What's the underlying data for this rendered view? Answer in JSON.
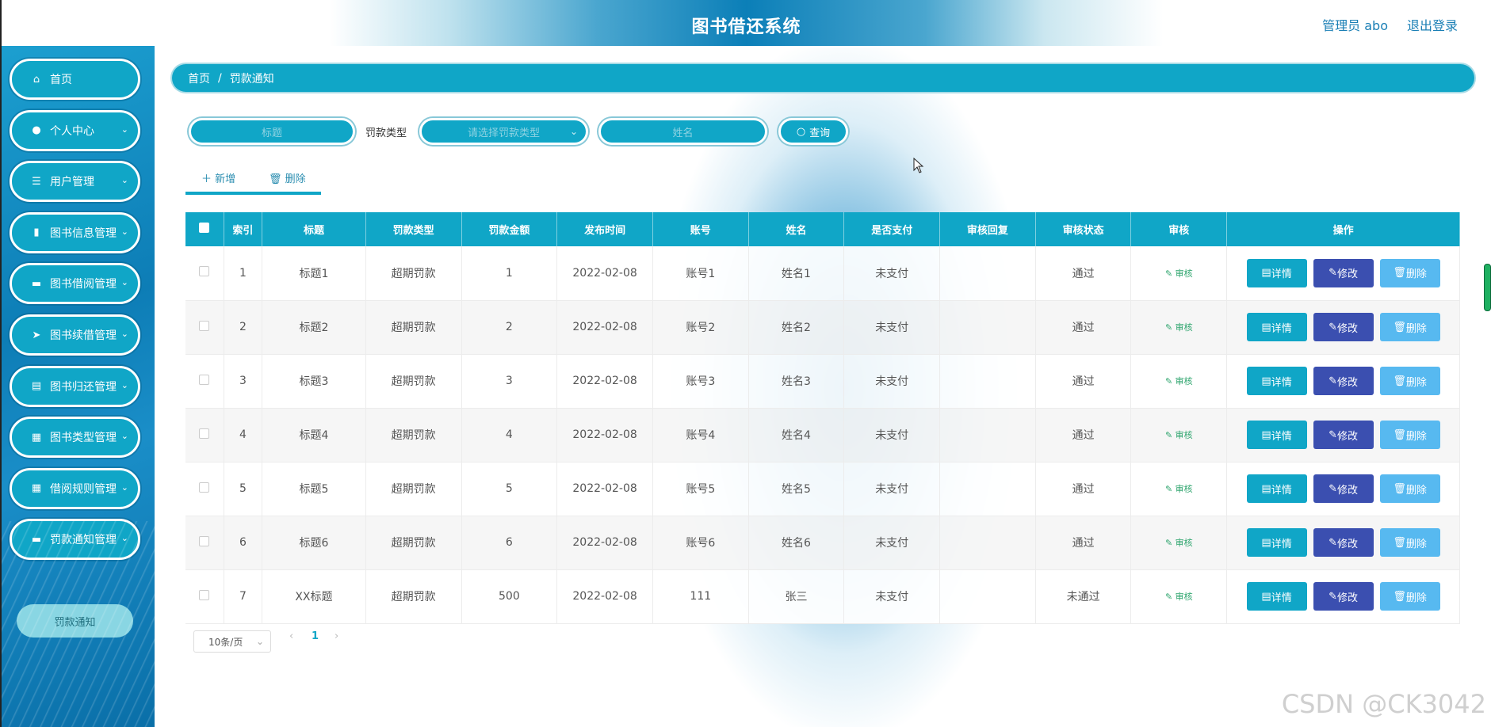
{
  "header": {
    "title": "图书借还系统",
    "user": "管理员 abo",
    "logout": "退出登录"
  },
  "sidebar": {
    "items": [
      {
        "label": "首页",
        "icon": "home-icon",
        "glyph": "⌂",
        "chevron": ""
      },
      {
        "label": "个人中心",
        "icon": "user-icon",
        "glyph": "●",
        "chevron": "⌄"
      },
      {
        "label": "用户管理",
        "icon": "list-icon",
        "glyph": "☰",
        "chevron": "⌄"
      },
      {
        "label": "图书信息管理",
        "icon": "chart-icon",
        "glyph": "▮",
        "chevron": "⌄"
      },
      {
        "label": "图书借阅管理",
        "icon": "briefcase-icon",
        "glyph": "▬",
        "chevron": "⌄"
      },
      {
        "label": "图书续借管理",
        "icon": "send-icon",
        "glyph": "➤",
        "chevron": "⌄"
      },
      {
        "label": "图书归还管理",
        "icon": "clipboard-icon",
        "glyph": "▤",
        "chevron": "⌄"
      },
      {
        "label": "图书类型管理",
        "icon": "grid-icon",
        "glyph": "▦",
        "chevron": "⌄"
      },
      {
        "label": "借阅规则管理",
        "icon": "grid-icon",
        "glyph": "▦",
        "chevron": "⌄"
      },
      {
        "label": "罚款通知管理",
        "icon": "monitor-icon",
        "glyph": "▬",
        "chevron": "⌄"
      }
    ],
    "submenu": "罚款通知"
  },
  "breadcrumb": {
    "home": "首页",
    "sep": "/",
    "current": "罚款通知"
  },
  "search": {
    "title_placeholder": "标题",
    "type_label": "罚款类型",
    "type_placeholder": "请选择罚款类型",
    "name_placeholder": "姓名",
    "button": "查询"
  },
  "actions": {
    "add": "新增",
    "delete": "删除"
  },
  "table": {
    "headers": [
      "索引",
      "标题",
      "罚款类型",
      "罚款金额",
      "发布时间",
      "账号",
      "姓名",
      "是否支付",
      "审核回复",
      "审核状态",
      "审核",
      "操作"
    ],
    "rows": [
      {
        "idx": "1",
        "title": "标题1",
        "type": "超期罚款",
        "amount": "1",
        "date": "2022-02-08",
        "account": "账号1",
        "name": "姓名1",
        "paid": "未支付",
        "reply": "",
        "status": "通过"
      },
      {
        "idx": "2",
        "title": "标题2",
        "type": "超期罚款",
        "amount": "2",
        "date": "2022-02-08",
        "account": "账号2",
        "name": "姓名2",
        "paid": "未支付",
        "reply": "",
        "status": "通过"
      },
      {
        "idx": "3",
        "title": "标题3",
        "type": "超期罚款",
        "amount": "3",
        "date": "2022-02-08",
        "account": "账号3",
        "name": "姓名3",
        "paid": "未支付",
        "reply": "",
        "status": "通过"
      },
      {
        "idx": "4",
        "title": "标题4",
        "type": "超期罚款",
        "amount": "4",
        "date": "2022-02-08",
        "account": "账号4",
        "name": "姓名4",
        "paid": "未支付",
        "reply": "",
        "status": "通过"
      },
      {
        "idx": "5",
        "title": "标题5",
        "type": "超期罚款",
        "amount": "5",
        "date": "2022-02-08",
        "account": "账号5",
        "name": "姓名5",
        "paid": "未支付",
        "reply": "",
        "status": "通过"
      },
      {
        "idx": "6",
        "title": "标题6",
        "type": "超期罚款",
        "amount": "6",
        "date": "2022-02-08",
        "account": "账号6",
        "name": "姓名6",
        "paid": "未支付",
        "reply": "",
        "status": "通过"
      },
      {
        "idx": "7",
        "title": "XX标题",
        "type": "超期罚款",
        "amount": "500",
        "date": "2022-02-08",
        "account": "111",
        "name": "张三",
        "paid": "未支付",
        "reply": "",
        "status": "未通过"
      }
    ],
    "audit_label": "审核",
    "op_detail": "详情",
    "op_edit": "修改",
    "op_delete": "删除"
  },
  "pagination": {
    "page_size": "10条/页",
    "current": "1",
    "prev": "‹",
    "next": "›"
  },
  "watermark": "CSDN @CK3042",
  "colors": {
    "primary": "#10a6c7",
    "edit": "#3b4fb0",
    "delete": "#57b9f0",
    "audit": "#2fa56e"
  }
}
